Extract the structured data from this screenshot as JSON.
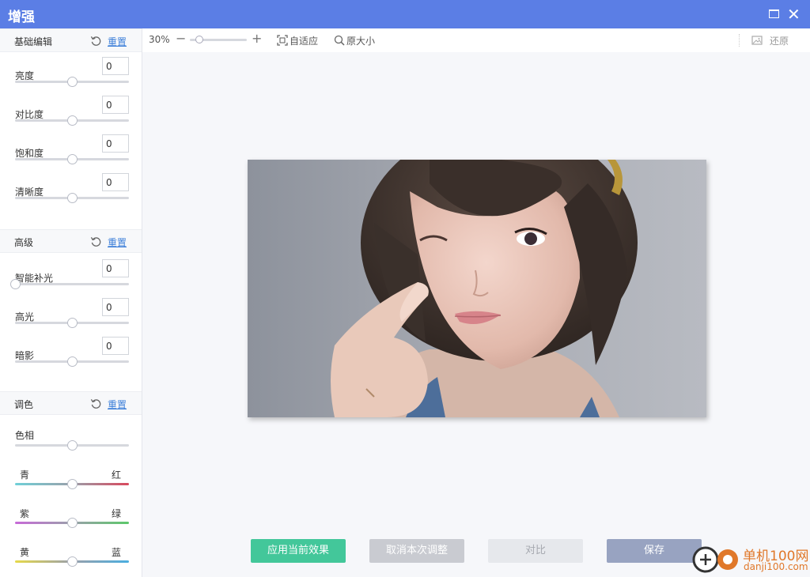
{
  "window": {
    "title": "增强"
  },
  "sections": {
    "basic": {
      "title": "基础编辑",
      "reset_label": "重置"
    },
    "advanced": {
      "title": "高级",
      "reset_label": "重置"
    },
    "tone": {
      "title": "调色",
      "reset_label": "重置"
    }
  },
  "basic_params": [
    {
      "label": "亮度",
      "value": "0",
      "level": 0.5
    },
    {
      "label": "对比度",
      "value": "0",
      "level": 0.5
    },
    {
      "label": "饱和度",
      "value": "0",
      "level": 0.5
    },
    {
      "label": "清晰度",
      "value": "0",
      "level": 0.5
    }
  ],
  "advanced_params": [
    {
      "label": "智能补光",
      "value": "0",
      "level": 0.0
    },
    {
      "label": "高光",
      "value": "0",
      "level": 0.5
    },
    {
      "label": "暗影",
      "value": "0",
      "level": 0.5
    }
  ],
  "tone_params": {
    "hue": {
      "label": "色相",
      "level": 0.5
    },
    "cyan_red": {
      "left": "青",
      "right": "红",
      "level": 0.5,
      "left_color": "#6fd0d8",
      "right_color": "#d9485d"
    },
    "magenta_green": {
      "left": "紫",
      "right": "绿",
      "level": 0.5,
      "left_color": "#c76ad8",
      "right_color": "#5cc86a"
    },
    "yellow_blue": {
      "left": "黄",
      "right": "蓝",
      "level": 0.5,
      "left_color": "#e6d94a",
      "right_color": "#4aaee0"
    }
  },
  "toolbar": {
    "zoom": "30%",
    "zoom_level": 0.1,
    "fit_label": "自适应",
    "original_label": "原大小",
    "restore_label": "还原"
  },
  "actions": {
    "apply": "应用当前效果",
    "cancel": "取消本次调整",
    "compare": "对比",
    "save": "保存"
  },
  "watermark": {
    "name": "单机100网",
    "url": "danji100.com"
  },
  "colors": {
    "titlebar": "#5b7ee5",
    "apply": "#43c79a",
    "link": "#3d7fd9"
  }
}
